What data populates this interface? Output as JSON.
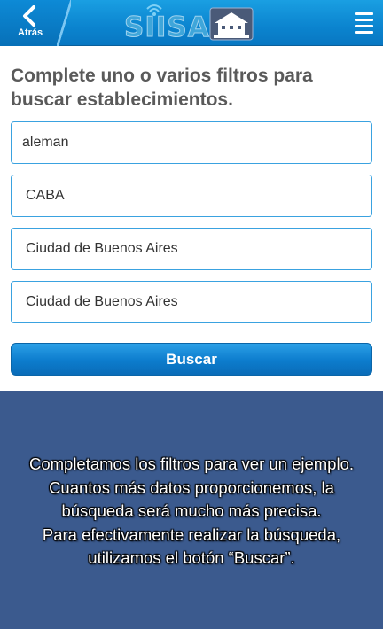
{
  "header": {
    "back_label": "Atrás",
    "logo_text": "SIISA",
    "icons": {
      "back": "chevron-left-icon",
      "menu": "hamburger-menu-icon",
      "logo": "siisa-logo"
    },
    "colors": {
      "bar": "#0b84cf",
      "accent": "#3aa2e0"
    }
  },
  "form": {
    "prompt": "Complete uno o varios filtros para buscar establecimientos.",
    "fields": [
      {
        "value": "aleman"
      },
      {
        "value": "CABA"
      },
      {
        "value": "Ciudad de Buenos Aires"
      },
      {
        "value": "Ciudad de Buenos Aires"
      }
    ],
    "search_label": "Buscar"
  },
  "overlay": {
    "background": "#3b5a8e",
    "lines": [
      "Completamos los filtros para ver un ejemplo.",
      "Cuantos más datos proporcionemos, la",
      "búsqueda será mucho más precisa.",
      "Para efectivamente realizar la búsqueda,",
      "utilizamos el botón “Buscar”."
    ]
  }
}
